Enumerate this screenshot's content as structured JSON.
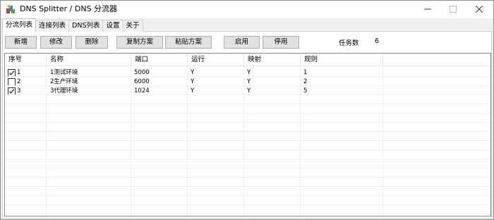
{
  "window": {
    "title": "DNS Splitter / DNS 分流器"
  },
  "tabs": [
    {
      "label": "分流列表",
      "active": true
    },
    {
      "label": "连接列表",
      "active": false
    },
    {
      "label": "DNS列表",
      "active": false
    },
    {
      "label": "设置",
      "active": false
    },
    {
      "label": "关于",
      "active": false
    }
  ],
  "toolbar": {
    "add": "新增",
    "edit": "修改",
    "delete": "删除",
    "copy_plan": "复制方案",
    "paste_plan": "粘贴方案",
    "enable": "启用",
    "disable": "停用",
    "task_count_label": "任务数",
    "task_count_value": "6"
  },
  "table": {
    "columns": [
      "序号",
      "名称",
      "端口",
      "运行",
      "映射",
      "规则"
    ],
    "rows": [
      {
        "checked": true,
        "id": "1",
        "name": "1测试环境",
        "port": "5000",
        "run": "Y",
        "map": "Y",
        "rule": "1"
      },
      {
        "checked": false,
        "id": "2",
        "name": "2生产环境",
        "port": "6000",
        "run": "Y",
        "map": "Y",
        "rule": "2"
      },
      {
        "checked": true,
        "id": "3",
        "name": "3代理环境",
        "port": "1024",
        "run": "Y",
        "map": "Y",
        "rule": "5"
      }
    ]
  },
  "icons": {
    "app": "dns-splitter-app-icon",
    "minimize": "minimize-icon",
    "maximize": "maximize-icon",
    "close": "close-icon",
    "check": "checkmark-icon"
  }
}
